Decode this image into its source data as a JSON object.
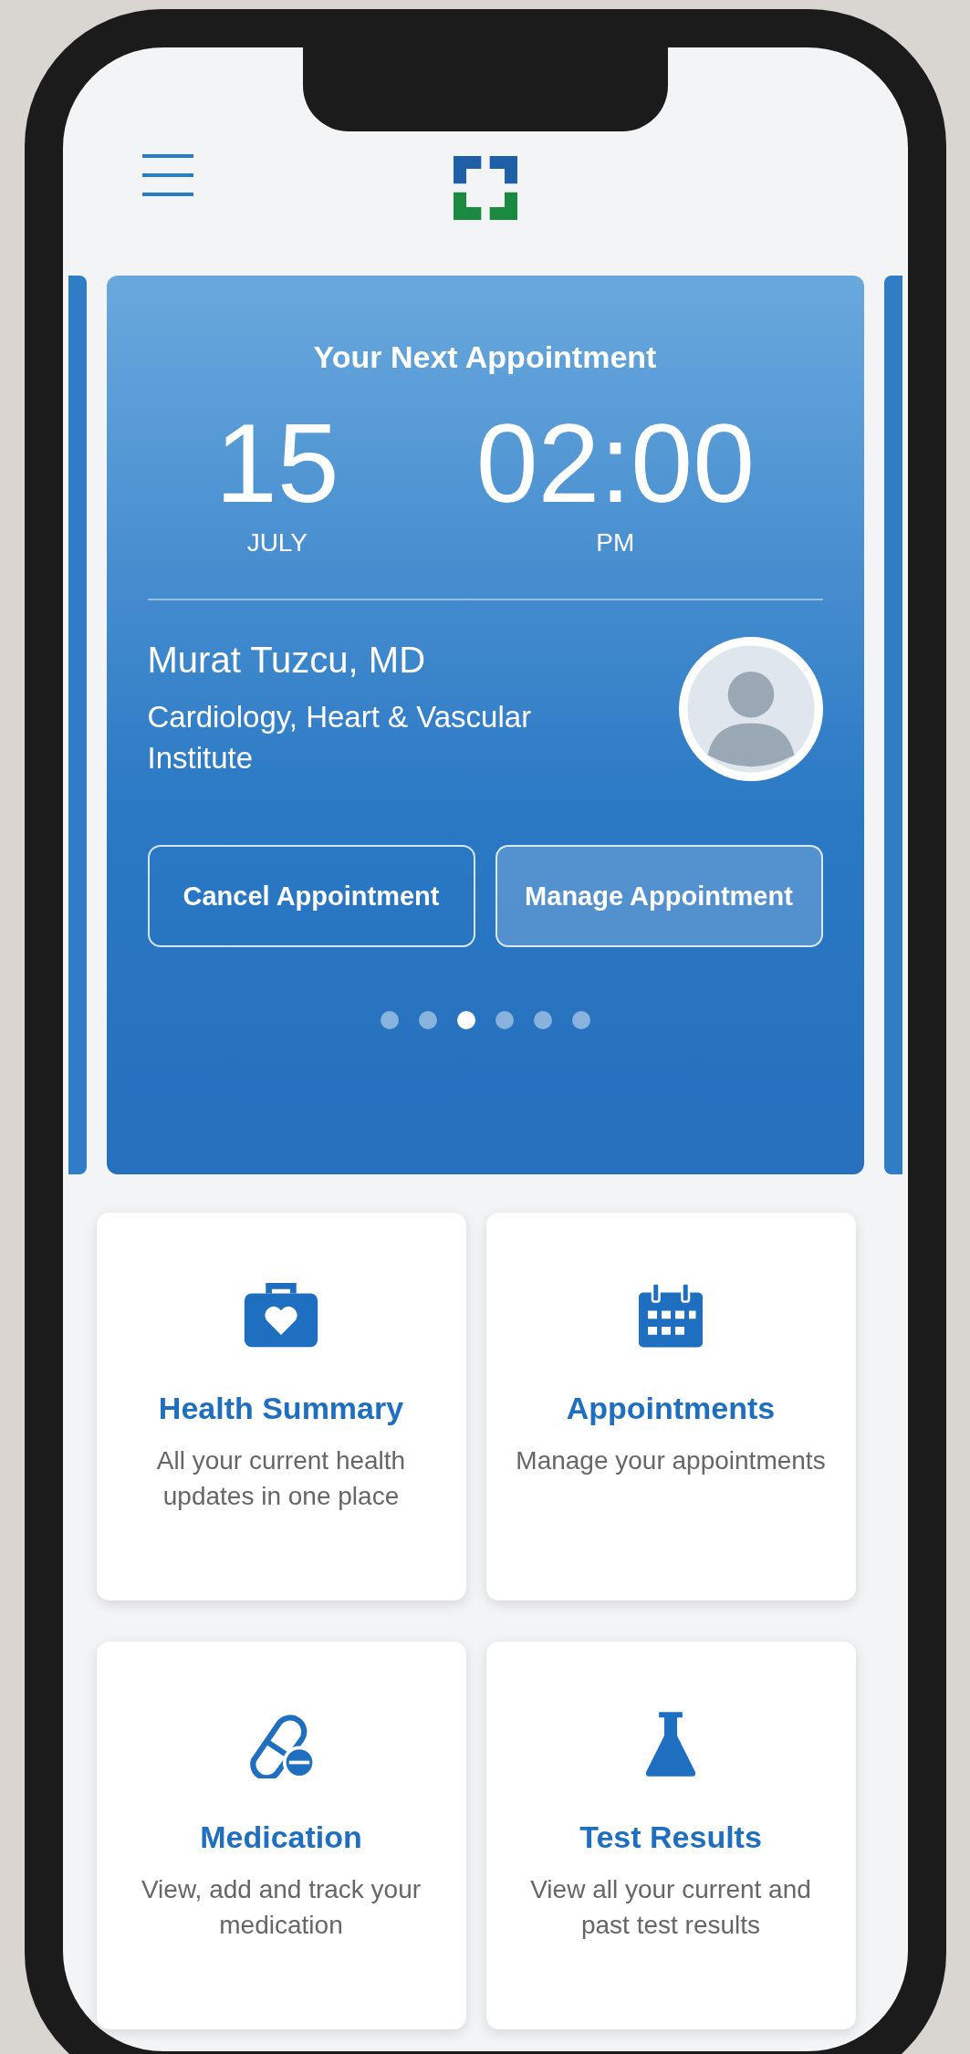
{
  "appointment_card": {
    "title": "Your Next Appointment",
    "day": "15",
    "month": "JULY",
    "time": "02:00",
    "period": "PM",
    "doctor": "Murat Tuzcu, MD",
    "specialty": "Cardiology, Heart & Vascular Institute",
    "buttons": [
      {
        "label": "Cancel Appointment",
        "kind": "outline"
      },
      {
        "label": "Manage Appointment",
        "kind": "filled"
      }
    ],
    "pager": [
      {
        "selected": false
      },
      {
        "selected": false
      },
      {
        "selected": true
      },
      {
        "selected": false
      },
      {
        "selected": false
      },
      {
        "selected": false
      }
    ]
  },
  "tiles": [
    {
      "kind": "health",
      "title": "Health Summary",
      "description": "All your current health updates in one place"
    },
    {
      "kind": "calendar",
      "title": "Appointments",
      "description": "Manage your appointments"
    },
    {
      "kind": "pills",
      "title": "Medication",
      "description": "View, add and track your medication"
    },
    {
      "kind": "flask",
      "title": "Test Results",
      "description": "View all your current and past test results"
    }
  ]
}
